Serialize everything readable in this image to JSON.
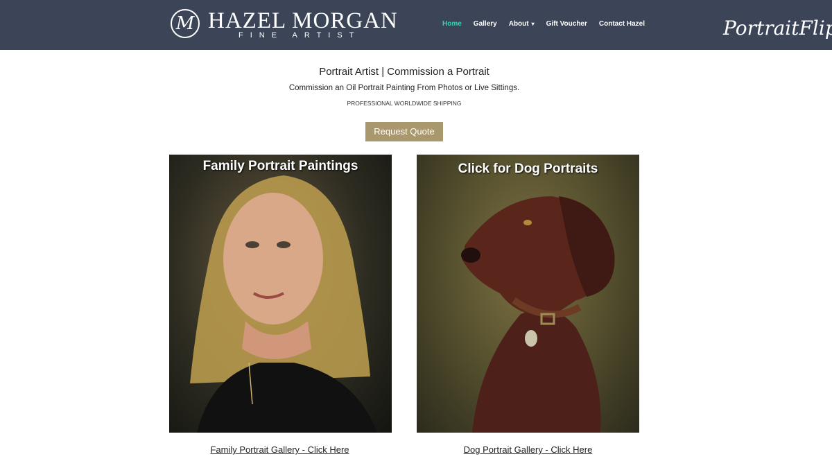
{
  "header": {
    "logo_monogram": "M",
    "logo_name": "HAZEL MORGAN",
    "logo_sub": "FINE ARTIST",
    "nav": [
      {
        "label": "Home",
        "active": true
      },
      {
        "label": "Gallery"
      },
      {
        "label": "About",
        "has_dropdown": true
      },
      {
        "label": "Gift Voucher"
      },
      {
        "label": "Contact Hazel"
      }
    ],
    "watermark": "PortraitFlip"
  },
  "intro": {
    "title": "Portrait Artist | Commission a Portrait",
    "subtitle": "Commission an Oil Portrait Painting From Photos or Live Sittings.",
    "shipping": "PROFESSIONAL WORLDWIDE SHIPPING",
    "button": "Request Quote"
  },
  "cards": [
    {
      "caption": "Family Portrait Paintings",
      "link": "Family Portrait Gallery - Click Here"
    },
    {
      "caption": "Click for Dog Portraits",
      "link": "Dog Portrait Gallery - Click Here"
    }
  ],
  "colors": {
    "header_bg": "#3b4557",
    "nav_active": "#2fd5b0",
    "button_bg": "#a9986e"
  }
}
